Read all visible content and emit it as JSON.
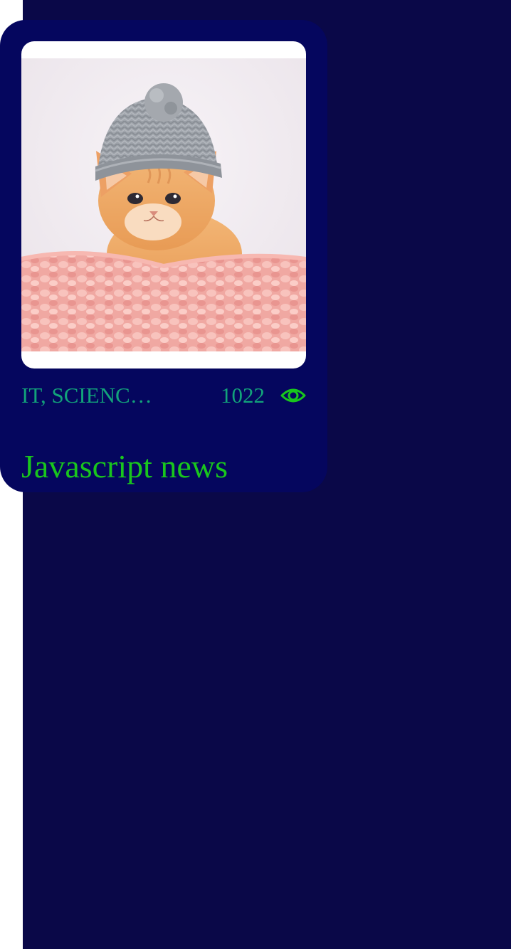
{
  "card": {
    "image_alt": "kitten wearing a gray knit hat on a pink knitted blanket",
    "categories": "IT, SCIENC…",
    "views": "1022",
    "views_icon": "eye-icon",
    "title": "Javascript news"
  },
  "colors": {
    "page_background": "#0a0848",
    "card_background": "#05065e",
    "meta_text": "#12a37a",
    "title_text": "#19c61d",
    "eye_icon": "#19c61d"
  }
}
